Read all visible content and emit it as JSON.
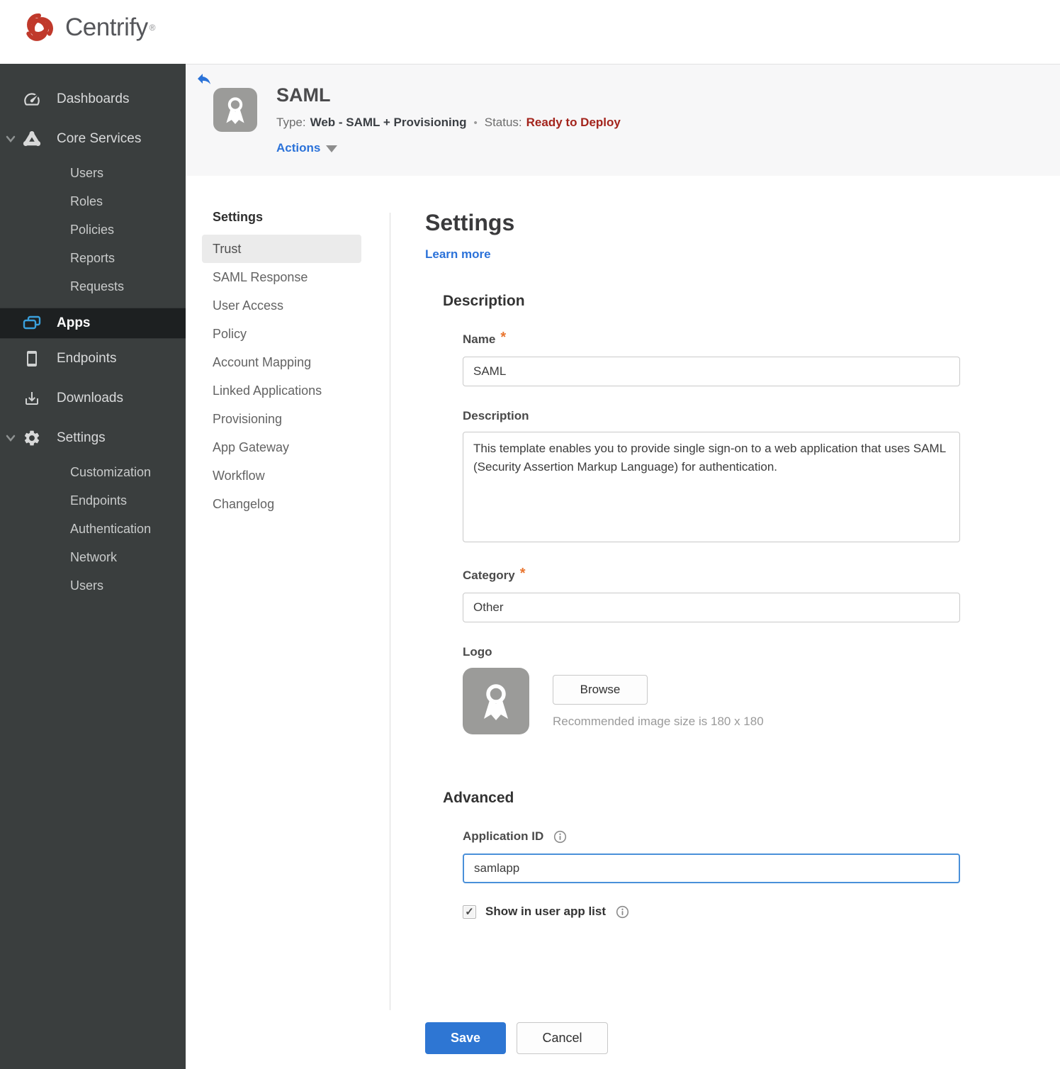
{
  "brand": {
    "name": "Centrify",
    "trademark": "®"
  },
  "sidebar": {
    "dashboards": "Dashboards",
    "core_services": "Core Services",
    "core_children": [
      "Users",
      "Roles",
      "Policies",
      "Reports",
      "Requests"
    ],
    "apps": "Apps",
    "endpoints": "Endpoints",
    "downloads": "Downloads",
    "settings": "Settings",
    "settings_children": [
      "Customization",
      "Endpoints",
      "Authentication",
      "Network",
      "Users"
    ]
  },
  "app_header": {
    "title": "SAML",
    "type_label": "Type:",
    "type_value": "Web - SAML + Provisioning",
    "separator": "•",
    "status_label": "Status:",
    "status_value": "Ready to Deploy",
    "actions_label": "Actions"
  },
  "subnav": {
    "heading": "Settings",
    "selected": "Trust",
    "items": [
      "Trust",
      "SAML Response",
      "User Access",
      "Policy",
      "Account Mapping",
      "Linked Applications",
      "Provisioning",
      "App Gateway",
      "Workflow",
      "Changelog"
    ]
  },
  "form": {
    "title": "Settings",
    "learn_more": "Learn more",
    "description_section": "Description",
    "required_marker": "*",
    "name_label": "Name",
    "name_value": "SAML",
    "description_label": "Description",
    "description_value": "This template enables you to provide single sign-on to a web application that uses SAML (Security Assertion Markup Language) for authentication.",
    "category_label": "Category",
    "category_value": "Other",
    "logo_label": "Logo",
    "browse_label": "Browse",
    "logo_hint": "Recommended image size is 180 x 180",
    "advanced_section": "Advanced",
    "application_id_label": "Application ID",
    "application_id_value": "samlapp",
    "show_in_app_list_label": "Show in user app list",
    "checkbox_glyph": "✓",
    "save_label": "Save",
    "cancel_label": "Cancel"
  },
  "colors": {
    "accent_blue": "#2b72d9",
    "save_button_blue": "#2e76d3",
    "status_red": "#a3241c",
    "required_orange": "#e9752f",
    "sidebar_bg": "#3a3e3e",
    "apps_icon_blue": "#3aa0dd",
    "header_band_bg": "#f7f7f8"
  }
}
